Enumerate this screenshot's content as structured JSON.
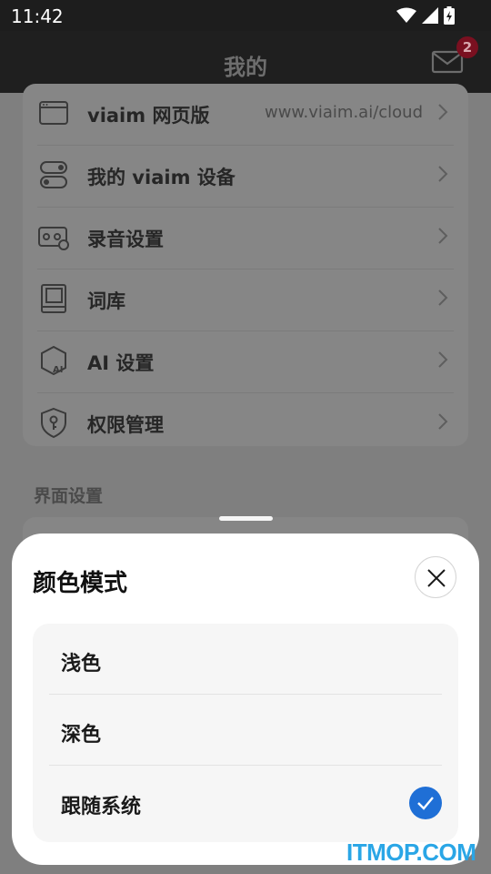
{
  "status_bar": {
    "time": "11:42"
  },
  "app_bar": {
    "title": "我的",
    "unread_count": "2"
  },
  "menu": [
    {
      "label": "viaim 网页版",
      "value": "www.viaim.ai/cloud",
      "icon": "browser-icon"
    },
    {
      "label": "我的 viaim 设备",
      "value": "",
      "icon": "toggle-device-icon"
    },
    {
      "label": "录音设置",
      "value": "",
      "icon": "recorder-settings-icon"
    },
    {
      "label": "词库",
      "value": "",
      "icon": "book-icon"
    },
    {
      "label": "AI 设置",
      "value": "",
      "icon": "ai-hexagon-icon"
    },
    {
      "label": "权限管理",
      "value": "",
      "icon": "shield-key-icon"
    }
  ],
  "section": {
    "interface_settings": "界面设置"
  },
  "sheet": {
    "title": "颜色模式",
    "options": [
      {
        "label": "浅色",
        "selected": false
      },
      {
        "label": "深色",
        "selected": false
      },
      {
        "label": "跟随系统",
        "selected": true
      }
    ]
  },
  "watermark": "ITMOP.COM",
  "colors": {
    "accent": "#1f6fd6",
    "badge": "#7a1020",
    "watermark": "#2aa6e6"
  }
}
